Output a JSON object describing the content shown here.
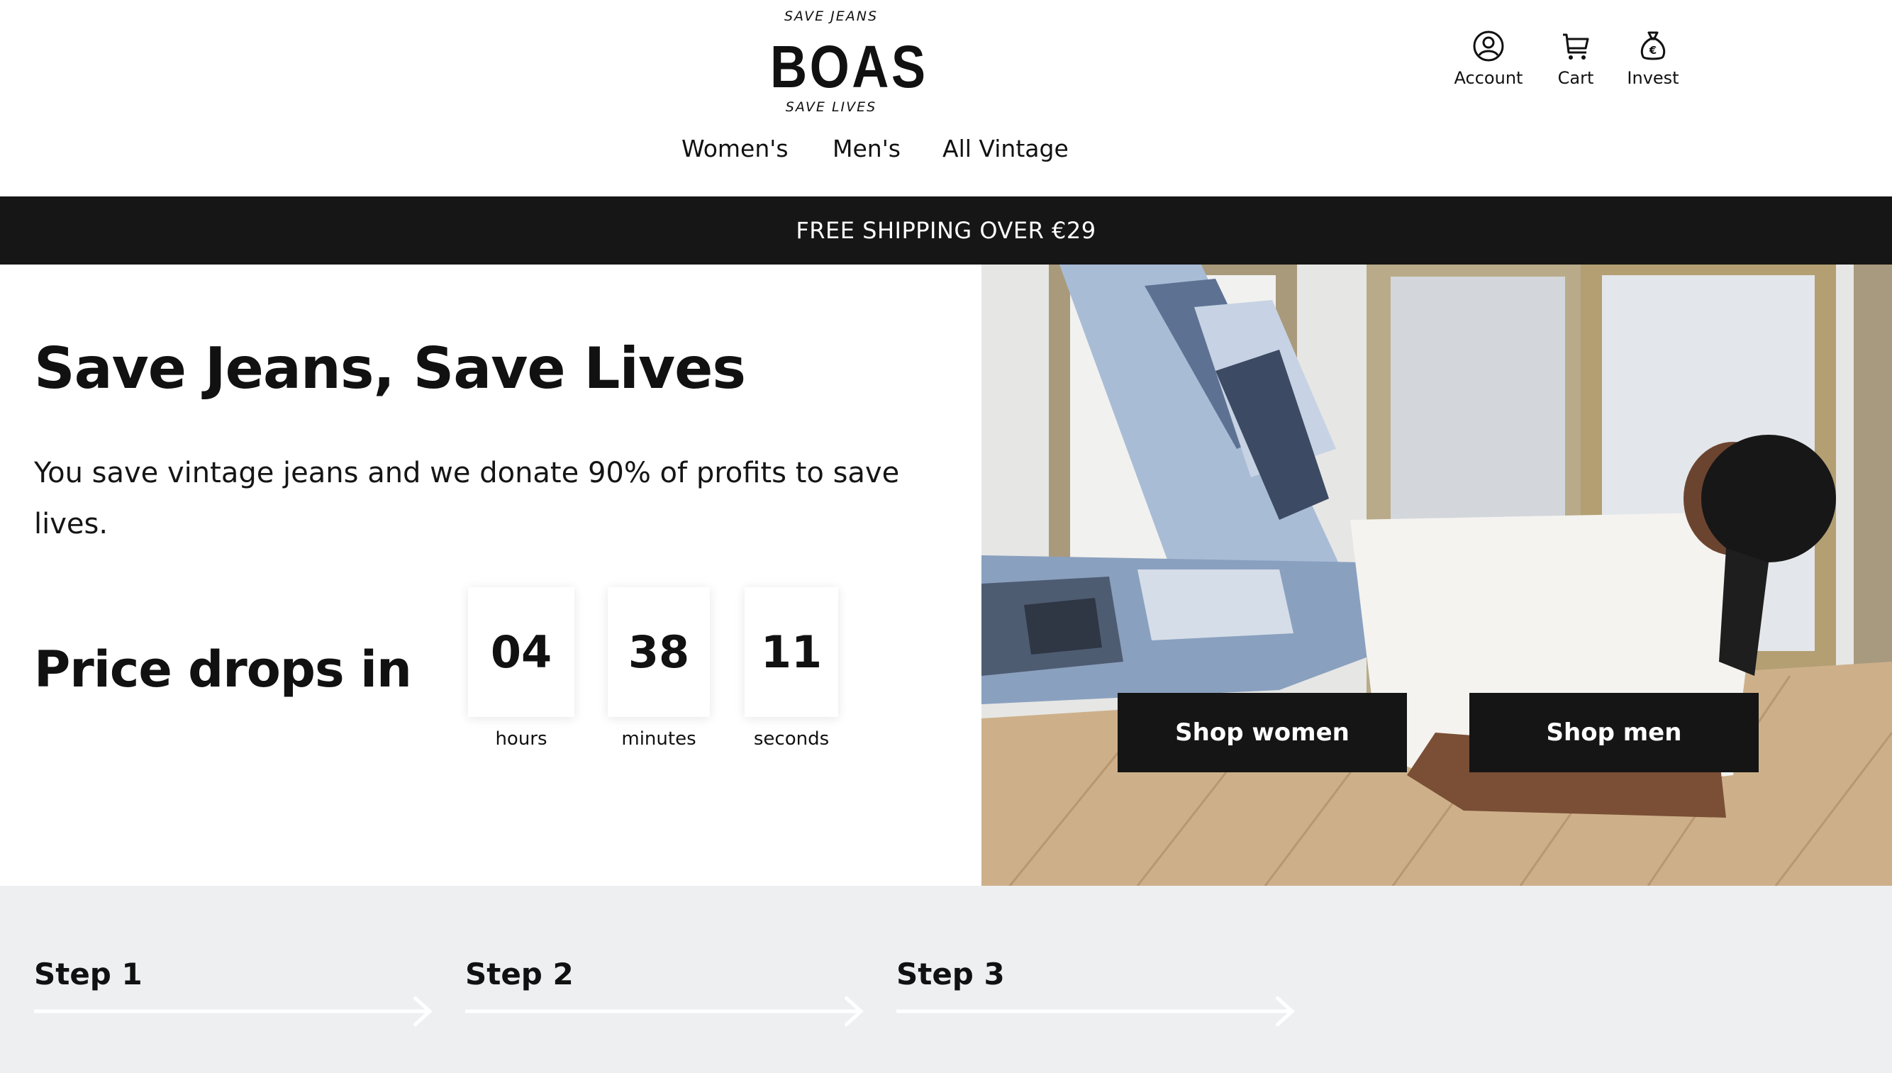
{
  "header": {
    "logo": {
      "top_text": "SAVE JEANS",
      "wordmark": "BOAS",
      "bottom_text": "SAVE LIVES"
    },
    "nav": [
      {
        "label": "Women's"
      },
      {
        "label": "Men's"
      },
      {
        "label": "All Vintage"
      }
    ],
    "utility": [
      {
        "label": "Account",
        "icon": "account-icon"
      },
      {
        "label": "Cart",
        "icon": "cart-icon"
      },
      {
        "label": "Invest",
        "icon": "money-bag-icon"
      }
    ]
  },
  "announcement": {
    "text": "FREE SHIPPING OVER €29"
  },
  "hero": {
    "title": "Save Jeans, Save Lives",
    "subtitle": "You save vintage jeans and we donate 90% of profits to save lives.",
    "countdown": {
      "label": "Price drops in",
      "units": [
        {
          "value": "04",
          "unit": "hours"
        },
        {
          "value": "38",
          "unit": "minutes"
        },
        {
          "value": "11",
          "unit": "seconds"
        }
      ]
    },
    "buttons": {
      "women": "Shop women",
      "men": "Shop men"
    }
  },
  "steps": [
    {
      "label": "Step 1"
    },
    {
      "label": "Step 2"
    },
    {
      "label": "Step 3"
    }
  ],
  "colors": {
    "dark": "#161616",
    "steps_bg": "#eeeff1",
    "text": "#111111"
  }
}
